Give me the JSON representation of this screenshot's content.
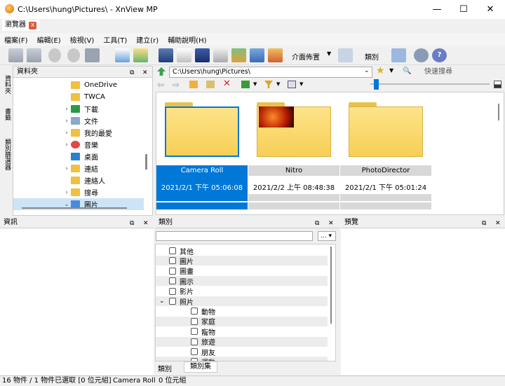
{
  "window": {
    "title": "C:\\Users\\hung\\Pictures\\ - XnView MP",
    "min": "—",
    "max": "☐",
    "close": "✕"
  },
  "tab": {
    "label": "瀏覽器",
    "close": "x"
  },
  "menu": [
    "檔案(F)",
    "編輯(E)",
    "檢視(V)",
    "工具(T)",
    "建立(r)",
    "輔助說明(H)"
  ],
  "toolbar": {
    "layout_label": "介面佈置",
    "category_label": "類別"
  },
  "left_tabs": [
    "資料夾",
    "書籤",
    "類別篩選器"
  ],
  "folders": {
    "title": "資料夾",
    "items": [
      {
        "label": "OneDrive",
        "expand": ""
      },
      {
        "label": "TWCA",
        "expand": ""
      },
      {
        "label": "下載",
        "expand": "›"
      },
      {
        "label": "文件",
        "expand": "›"
      },
      {
        "label": "我的最愛",
        "expand": "›"
      },
      {
        "label": "音樂",
        "expand": "›"
      },
      {
        "label": "桌面",
        "expand": ""
      },
      {
        "label": "連結",
        "expand": "›"
      },
      {
        "label": "連絡人",
        "expand": ""
      },
      {
        "label": "搜尋",
        "expand": "›"
      },
      {
        "label": "圖片",
        "expand": "⌄"
      }
    ]
  },
  "address": {
    "path": "C:\\Users\\hung\\Pictures\\",
    "search_placeholder": "快速搜尋"
  },
  "thumbnails": [
    {
      "name": "Camera Roll",
      "date": "2021/2/1 下午 05:06:08",
      "selected": true
    },
    {
      "name": "Nitro",
      "date": "2021/2/2 上午 08:48:38",
      "selected": false
    },
    {
      "name": "PhotoDirector",
      "date": "2021/2/1 下午 05:01:24",
      "selected": false
    }
  ],
  "info": {
    "title": "資訊"
  },
  "categories": {
    "title": "類別",
    "filter_btn": "...",
    "items": [
      {
        "label": "其他",
        "indent": 0,
        "arrow": ""
      },
      {
        "label": "圖片",
        "indent": 0,
        "arrow": ""
      },
      {
        "label": "圖畫",
        "indent": 0,
        "arrow": ""
      },
      {
        "label": "圖示",
        "indent": 0,
        "arrow": ""
      },
      {
        "label": "影片",
        "indent": 0,
        "arrow": ""
      },
      {
        "label": "照片",
        "indent": 0,
        "arrow": "⌄"
      },
      {
        "label": "動物",
        "indent": 1,
        "arrow": ""
      },
      {
        "label": "家庭",
        "indent": 1,
        "arrow": ""
      },
      {
        "label": "寵物",
        "indent": 1,
        "arrow": ""
      },
      {
        "label": "旅遊",
        "indent": 1,
        "arrow": ""
      },
      {
        "label": "朋友",
        "indent": 1,
        "arrow": ""
      },
      {
        "label": "運動",
        "indent": 1,
        "arrow": ""
      }
    ],
    "tab1": "類別",
    "tab2": "類別集"
  },
  "preview": {
    "title": "預覽"
  },
  "status": {
    "count": "16 物件 / 1 物件已選取 [0 位元組]",
    "selected": "Camera Roll",
    "size": "0 位元組"
  }
}
